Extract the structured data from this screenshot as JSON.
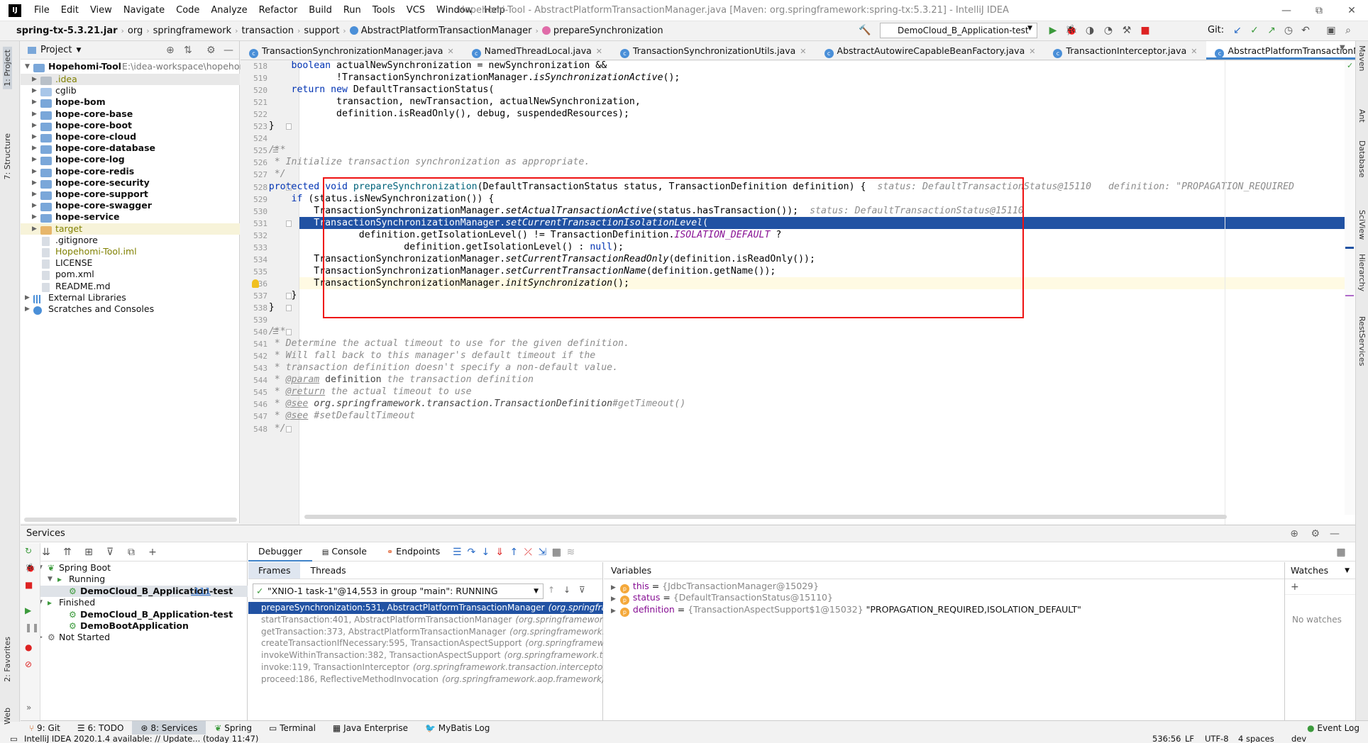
{
  "window": {
    "title": "Hopehomi-Tool - AbstractPlatformTransactionManager.java [Maven: org.springframework:spring-tx:5.3.21] - IntelliJ IDEA",
    "controls": [
      "—",
      "⧉",
      "✕"
    ]
  },
  "menu": [
    "File",
    "Edit",
    "View",
    "Navigate",
    "Code",
    "Analyze",
    "Refactor",
    "Build",
    "Run",
    "Tools",
    "VCS",
    "Window",
    "Help"
  ],
  "navbar": {
    "crumbs": [
      "spring-tx-5.3.21.jar",
      "org",
      "springframework",
      "transaction",
      "support",
      "AbstractPlatformTransactionManager",
      "prepareSynchronization"
    ],
    "run_config": "DemoCloud_B_Application-test",
    "git_label": "Git:"
  },
  "left_stripe": [
    "1: Project",
    "7: Structure",
    "2: Favorites",
    "Web"
  ],
  "right_stripe": [
    "Maven",
    "Ant",
    "Database",
    "SciView",
    "Hierarchy",
    "RestServices"
  ],
  "project": {
    "header": "Project",
    "root": {
      "name": "Hopehomi-Tool",
      "path": "E:\\idea-workspace\\hopehon"
    },
    "items": [
      {
        "label": ".idea",
        "type": "folder",
        "bold": false,
        "color": "#808000"
      },
      {
        "label": "cglib",
        "type": "folder",
        "bold": false
      },
      {
        "label": "hope-bom",
        "type": "module",
        "bold": true
      },
      {
        "label": "hope-core-base",
        "type": "module",
        "bold": true
      },
      {
        "label": "hope-core-boot",
        "type": "module",
        "bold": true
      },
      {
        "label": "hope-core-cloud",
        "type": "module",
        "bold": true
      },
      {
        "label": "hope-core-database",
        "type": "module",
        "bold": true
      },
      {
        "label": "hope-core-log",
        "type": "module",
        "bold": true
      },
      {
        "label": "hope-core-redis",
        "type": "module",
        "bold": true
      },
      {
        "label": "hope-core-security",
        "type": "module",
        "bold": true
      },
      {
        "label": "hope-core-support",
        "type": "module",
        "bold": true
      },
      {
        "label": "hope-core-swagger",
        "type": "module",
        "bold": true
      },
      {
        "label": "hope-service",
        "type": "module",
        "bold": true
      },
      {
        "label": "target",
        "type": "target",
        "bold": false,
        "color": "#808000"
      },
      {
        "label": ".gitignore",
        "type": "file",
        "bold": false
      },
      {
        "label": "Hopehomi-Tool.iml",
        "type": "file",
        "bold": false,
        "color": "#808000"
      },
      {
        "label": "LICENSE",
        "type": "file",
        "bold": false
      },
      {
        "label": "pom.xml",
        "type": "file",
        "bold": false
      },
      {
        "label": "README.md",
        "type": "file",
        "bold": false
      }
    ],
    "libs": "External Libraries",
    "scratches": "Scratches and Consoles"
  },
  "editor_tabs": [
    "TransactionSynchronizationManager.java",
    "NamedThreadLocal.java",
    "TransactionSynchronizationUtils.java",
    "AbstractAutowireCapableBeanFactory.java",
    "TransactionInterceptor.java",
    "AbstractPlatformTransactionManager.java"
  ],
  "line_numbers": [
    "518",
    "519",
    "520",
    "521",
    "522",
    "523",
    "524",
    "525",
    "526",
    "527",
    "528",
    "529",
    "530",
    "531",
    "532",
    "533",
    "534",
    "535",
    "536",
    "537",
    "538",
    "539",
    "540",
    "541",
    "542",
    "543",
    "544",
    "545",
    "546",
    "547",
    "548"
  ],
  "code_lines": [
    "        boolean actualNewSynchronization = newSynchronization &&",
    "                !TransactionSynchronizationManager.isSynchronizationActive();",
    "        return new DefaultTransactionStatus(",
    "                transaction, newTransaction, actualNewSynchronization,",
    "                definition.isReadOnly(), debug, suspendedResources);",
    "    }",
    "",
    "    /**",
    "     * Initialize transaction synchronization as appropriate.",
    "     */",
    "    protected void prepareSynchronization(DefaultTransactionStatus status, TransactionDefinition definition) {",
    "        if (status.isNewSynchronization()) {",
    "            TransactionSynchronizationManager.setActualTransactionActive(status.hasTransaction());",
    "            TransactionSynchronizationManager.setCurrentTransactionIsolationLevel(",
    "                    definition.getIsolationLevel() != TransactionDefinition.ISOLATION_DEFAULT ?",
    "                            definition.getIsolationLevel() : null);",
    "            TransactionSynchronizationManager.setCurrentTransactionReadOnly(definition.isReadOnly());",
    "            TransactionSynchronizationManager.setCurrentTransactionName(definition.getName());",
    "            TransactionSynchronizationManager.initSynchronization();",
    "        }",
    "    }",
    "",
    "    /**",
    "     * Determine the actual timeout to use for the given definition.",
    "     * Will fall back to this manager's default timeout if the",
    "     * transaction definition doesn't specify a non-default value.",
    "     * @param definition the transaction definition",
    "     * @return the actual timeout to use",
    "     * @see org.springframework.transaction.TransactionDefinition#getTimeout()",
    "     * @see #setDefaultTimeout",
    "     */"
  ],
  "inline_hints": {
    "line528": "status: DefaultTransactionStatus@15110   definition: \"PROPAGATION_REQUIRED",
    "line530": "status: DefaultTransactionStatus@15110"
  },
  "services": {
    "title": "Services",
    "tree": [
      {
        "label": "Spring Boot",
        "bold": false
      },
      {
        "label": "Running",
        "bold": false
      },
      {
        "label": "DemoCloud_B_Application-test",
        "bold": true,
        "suffix": ":111"
      },
      {
        "label": "Finished",
        "bold": false
      },
      {
        "label": "DemoCloud_B_Application-test",
        "bold": true
      },
      {
        "label": "DemoBootApplication",
        "bold": true
      },
      {
        "label": "Not Started",
        "bold": false
      }
    ],
    "debug_tabs": [
      "Debugger",
      "Console",
      "Endpoints"
    ],
    "frames_tabs": [
      "Frames",
      "Threads"
    ],
    "thread": "\"XNIO-1 task-1\"@14,553 in group \"main\": RUNNING",
    "frames": [
      {
        "method": "prepareSynchronization:531, AbstractPlatformTransactionManager",
        "pkg": "(org.springframework.transaction.support)"
      },
      {
        "method": "startTransaction:401, AbstractPlatformTransactionManager",
        "pkg": "(org.springframework.transaction.support)"
      },
      {
        "method": "getTransaction:373, AbstractPlatformTransactionManager",
        "pkg": "(org.springframework.transaction.support)"
      },
      {
        "method": "createTransactionIfNecessary:595, TransactionAspectSupport",
        "pkg": "(org.springframework.transaction.interceptor)"
      },
      {
        "method": "invokeWithinTransaction:382, TransactionAspectSupport",
        "pkg": "(org.springframework.transaction.interceptor)"
      },
      {
        "method": "invoke:119, TransactionInterceptor",
        "pkg": "(org.springframework.transaction.interceptor)"
      },
      {
        "method": "proceed:186, ReflectiveMethodInvocation",
        "pkg": "(org.springframework.aop.framework)"
      }
    ],
    "variables_title": "Variables",
    "variables": [
      {
        "name": "this",
        "value": "{JdbcTransactionManager@15029}",
        "extra": ""
      },
      {
        "name": "status",
        "value": "{DefaultTransactionStatus@15110}",
        "extra": ""
      },
      {
        "name": "definition",
        "value": "{TransactionAspectSupport$1@15032}",
        "extra": " \"PROPAGATION_REQUIRED,ISOLATION_DEFAULT\""
      }
    ],
    "watches_title": "Watches",
    "no_watches": "No watches"
  },
  "bottom_tabs": [
    "9: Git",
    "6: TODO",
    "8: Services",
    "Spring",
    "Terminal",
    "Java Enterprise",
    "MyBatis Log"
  ],
  "event_log": "Event Log",
  "status": {
    "message": "IntelliJ IDEA 2020.1.4 available: // Update... (today 11:47)",
    "position": "536:56",
    "line_sep": "LF",
    "encoding": "UTF-8",
    "indent": "4 spaces",
    "branch": "dev"
  },
  "colors": {
    "accent": "#2152a3",
    "red_box": "#ee1111",
    "hint": "#8c8c8c"
  }
}
